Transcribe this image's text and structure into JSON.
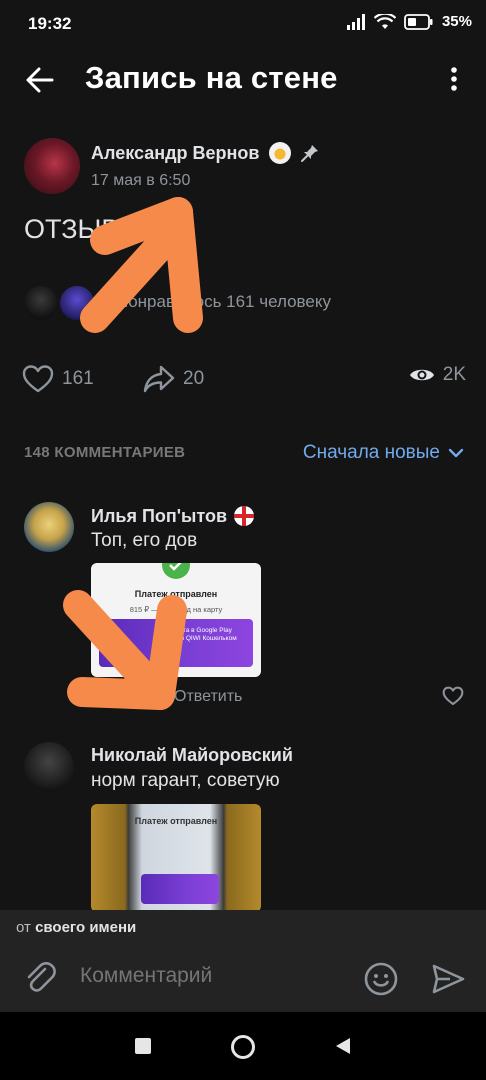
{
  "status_bar": {
    "time": "19:32",
    "battery": "35%"
  },
  "header": {
    "title": "Запись на стене"
  },
  "post": {
    "author_name": "Александр Вернов",
    "date": "17 мая в 6:50",
    "text": "ОТЗЫВЫ",
    "liked_by": "Понравилось 161 человеку",
    "likes": "161",
    "shares": "20",
    "views": "2K"
  },
  "comments_section": {
    "count_label": "148 КОММЕНТАРИЕВ",
    "sort_label": "Сначала новые"
  },
  "comments": [
    {
      "author": "Илья Поп'ытов",
      "text": "Топ, его дов",
      "image": {
        "title": "Платеж отправлен",
        "subtitle": "815 ₽ — Перевод на карту",
        "banner": "Оплата в Google Play через QIWI Кошельком"
      },
      "reply_label": "Ответить"
    },
    {
      "author": "Николай Майоровский",
      "text": "норм гарант, советую",
      "image": {
        "title": "Платеж отправлен"
      }
    }
  ],
  "anon_bar": {
    "prefix": "от",
    "name": "своего имени"
  },
  "composer": {
    "placeholder": "Комментарий"
  },
  "colors": {
    "background": "#141414",
    "accent": "#71aaeb",
    "annotation_arrow": "#f58a4a"
  }
}
